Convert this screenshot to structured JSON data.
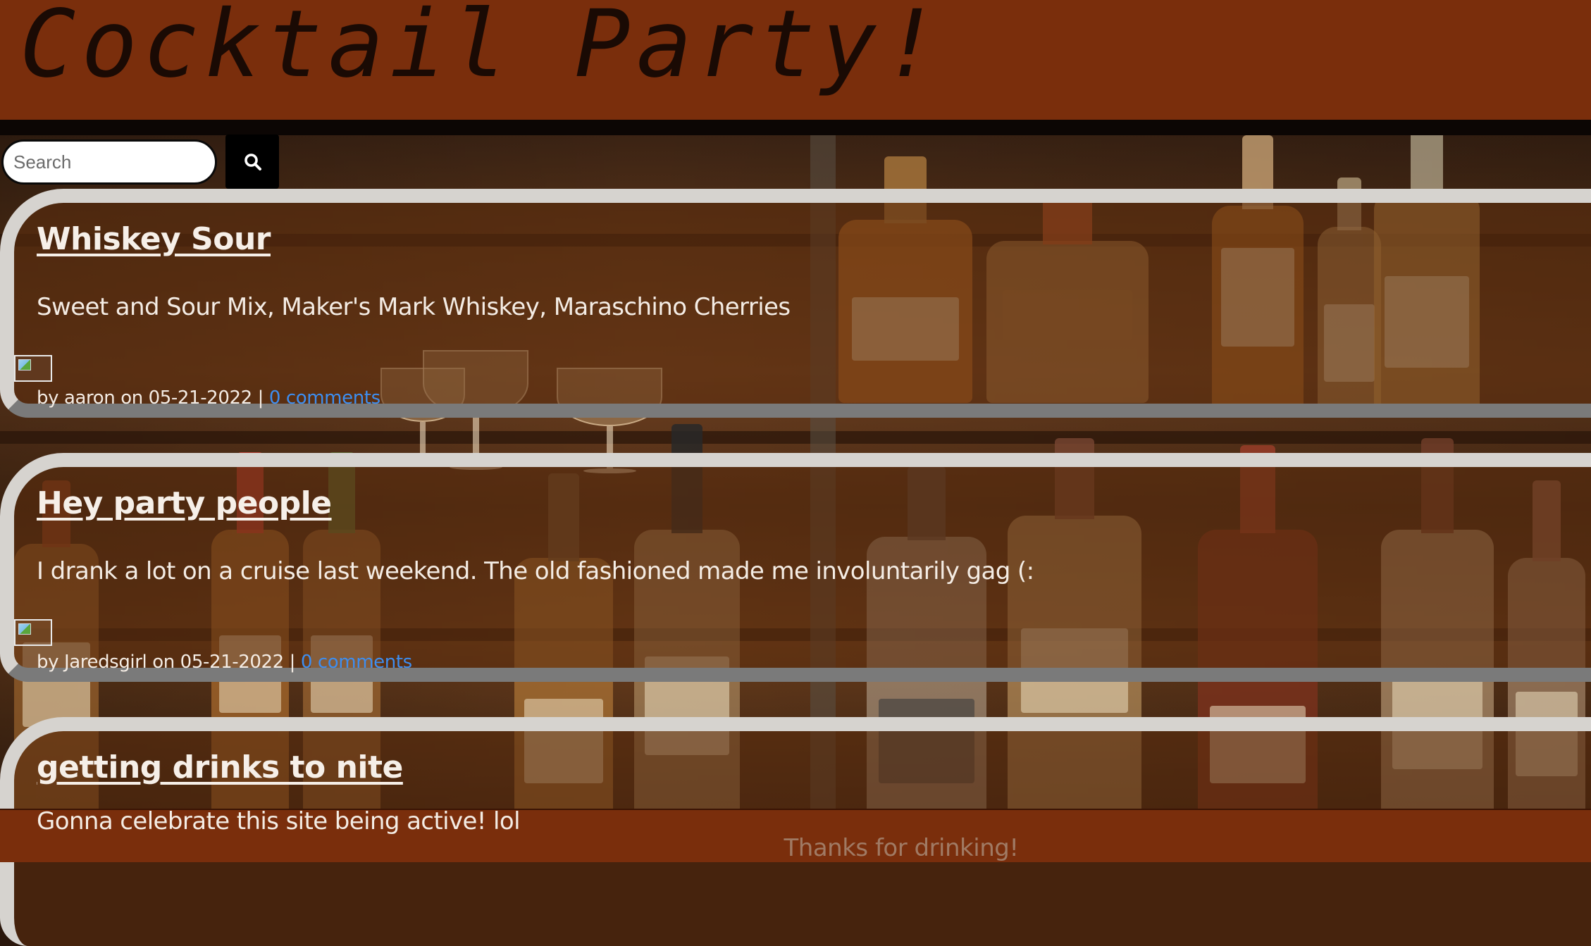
{
  "site": {
    "title": "Cocktail Party!",
    "footer_text": "Thanks for drinking!"
  },
  "search": {
    "placeholder": "Search",
    "value": "",
    "button_icon": "search-icon"
  },
  "posts": [
    {
      "title": "Whiskey Sour",
      "body": "Sweet and Sour Mix, Maker's Mark Whiskey, Maraschino Cherries",
      "meta_prefix": "by aaron on 05-21-2022 | ",
      "comments_label": "0 comments"
    },
    {
      "title": "Hey party people",
      "body": "I drank a lot on a cruise last weekend. The old fashioned made me involuntarily gag (:",
      "meta_prefix": "by Jaredsgirl on 05-21-2022 | ",
      "comments_label": "0 comments"
    },
    {
      "title": "getting drinks to nite",
      "body": "Gonna celebrate this site being active! lol"
    }
  ],
  "colors": {
    "header_bg": "#7a2e0c",
    "card_border": "#d6d3cf",
    "link": "#3d8ef0"
  }
}
